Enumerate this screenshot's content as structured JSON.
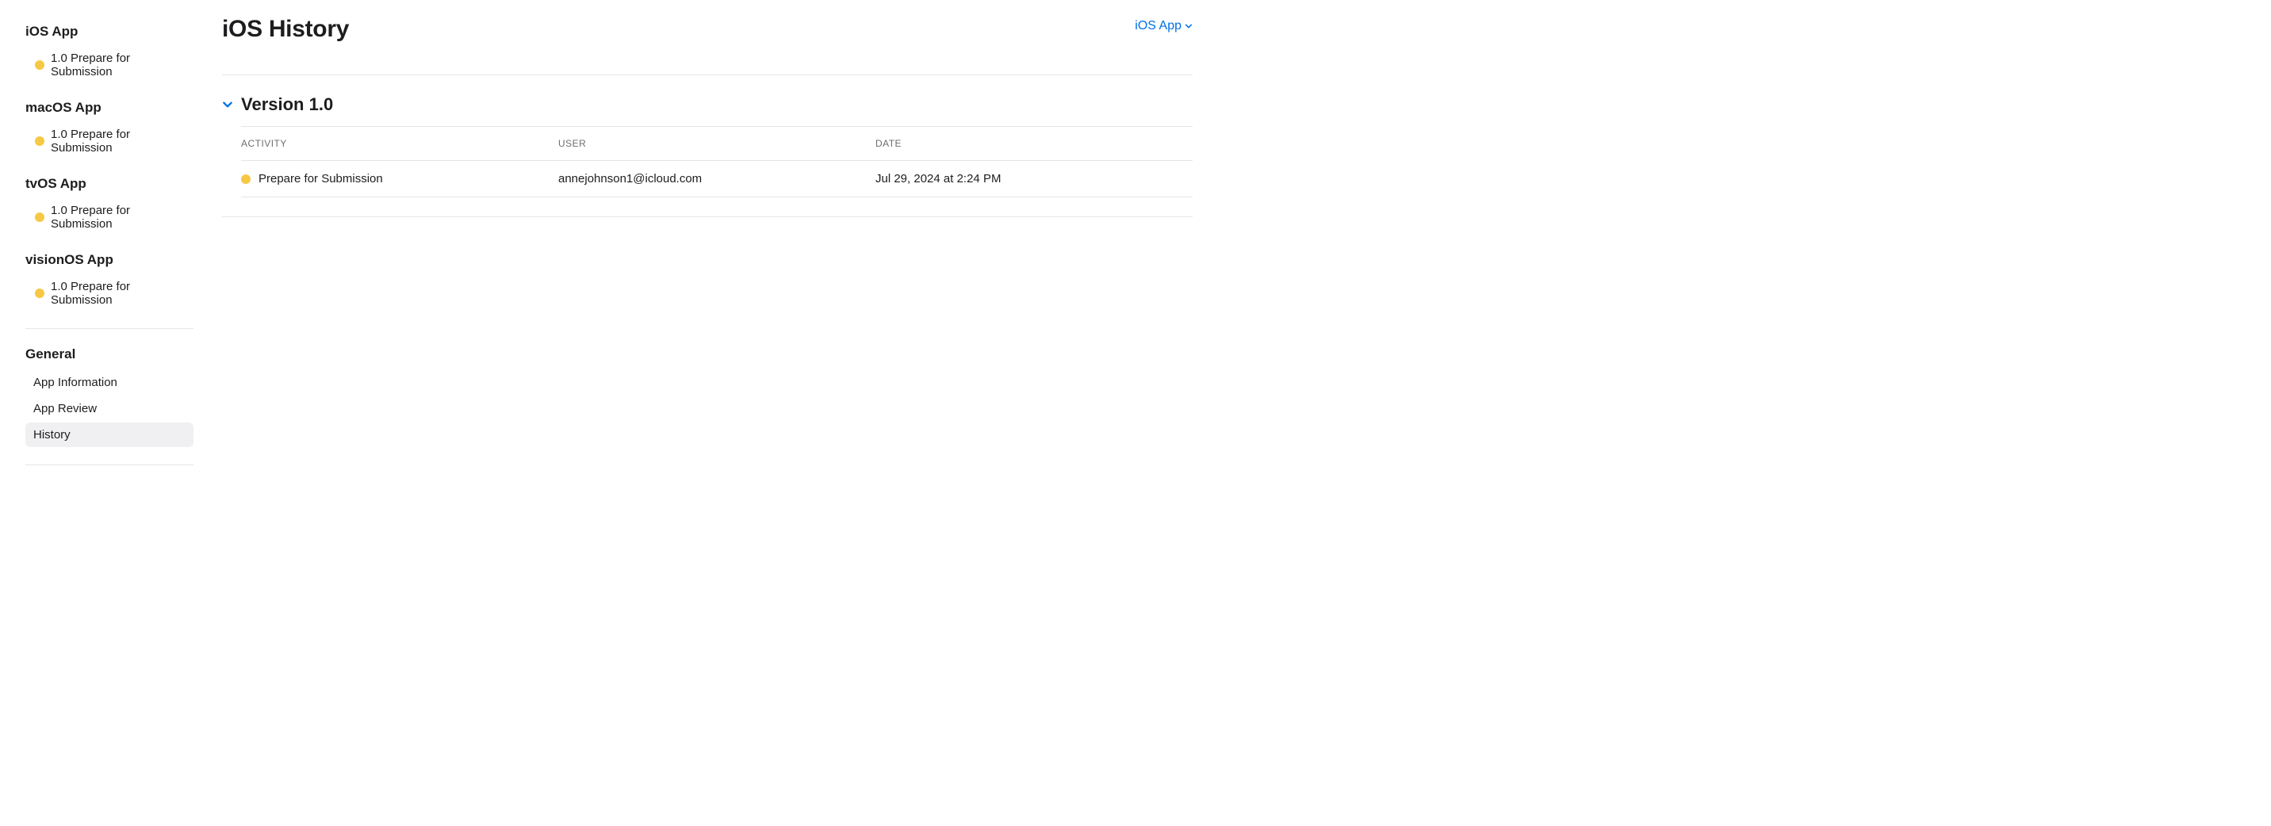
{
  "sidebar": {
    "platforms": [
      {
        "name": "iOS App",
        "status_label": "1.0 Prepare for Submission"
      },
      {
        "name": "macOS App",
        "status_label": "1.0 Prepare for Submission"
      },
      {
        "name": "tvOS App",
        "status_label": "1.0 Prepare for Submission"
      },
      {
        "name": "visionOS App",
        "status_label": "1.0 Prepare for Submission"
      }
    ],
    "general_heading": "General",
    "general_links": [
      {
        "label": "App Information",
        "active": false
      },
      {
        "label": "App Review",
        "active": false
      },
      {
        "label": "History",
        "active": true
      }
    ]
  },
  "header": {
    "title": "iOS History",
    "platform_selector": "iOS App"
  },
  "version_section": {
    "title": "Version 1.0",
    "columns": {
      "activity": "ACTIVITY",
      "user": "USER",
      "date": "DATE"
    },
    "rows": [
      {
        "activity": "Prepare for Submission",
        "user": "annejohnson1@icloud.com",
        "date": "Jul 29, 2024 at 2:24 PM"
      }
    ]
  }
}
